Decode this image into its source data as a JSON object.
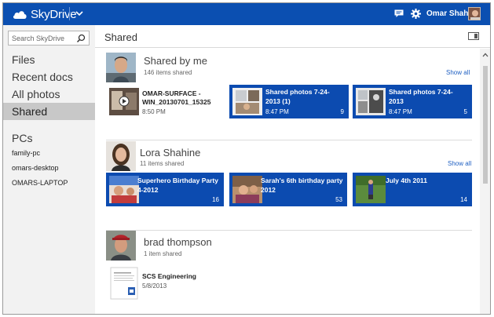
{
  "app": {
    "name": "SkyDrive",
    "user_name": "Omar Shahine",
    "colors": {
      "brand": "#0b4fb1",
      "tile": "#0c4bb0",
      "link": "#1e5fc2"
    }
  },
  "topbar_icons": {
    "chat": "chat-icon",
    "settings": "gear-icon",
    "menu": "chevron-down-icon"
  },
  "sidebar": {
    "search_placeholder": "Search SkyDrive",
    "nav": [
      {
        "label": "Files"
      },
      {
        "label": "Recent docs"
      },
      {
        "label": "All photos"
      },
      {
        "label": "Shared",
        "active": true
      }
    ],
    "pcs_heading": "PCs",
    "pcs": [
      {
        "label": "family-pc"
      },
      {
        "label": "omars-desktop"
      },
      {
        "label": "OMARS-LAPTOP"
      }
    ]
  },
  "main": {
    "title": "Shared",
    "sections": [
      {
        "name": "Shared by me",
        "count": "146 items shared",
        "show_all": "Show all",
        "tiles": [
          {
            "title_line1": "OMAR-SURFACE -",
            "title_line2": "WIN_20130701_15325",
            "date": "8:50 PM",
            "count": ""
          },
          {
            "title_line1": "Shared photos 7-24-",
            "title_line2": "2013 (1)",
            "date": "8:47 PM",
            "count": "9"
          },
          {
            "title_line1": "Shared photos 7-24-",
            "title_line2": "2013",
            "date": "8:47 PM",
            "count": "5"
          }
        ]
      },
      {
        "name": "Lora Shahine",
        "count": "11 items shared",
        "show_all": "Show all",
        "tiles": [
          {
            "title_line1": "Superhero Birthday Party",
            "title_line2": "4-2012",
            "date": "",
            "count": "16"
          },
          {
            "title_line1": "Sarah's 6th birthday party",
            "title_line2": "2012",
            "date": "",
            "count": "53"
          },
          {
            "title_line1": "July 4th 2011",
            "title_line2": "",
            "date": "",
            "count": "14"
          }
        ]
      },
      {
        "name": "brad thompson",
        "count": "1 item shared",
        "tiles": [
          {
            "title_line1": "SCS Engineering",
            "title_line2": "",
            "date": "5/8/2013",
            "count": ""
          }
        ]
      }
    ]
  }
}
